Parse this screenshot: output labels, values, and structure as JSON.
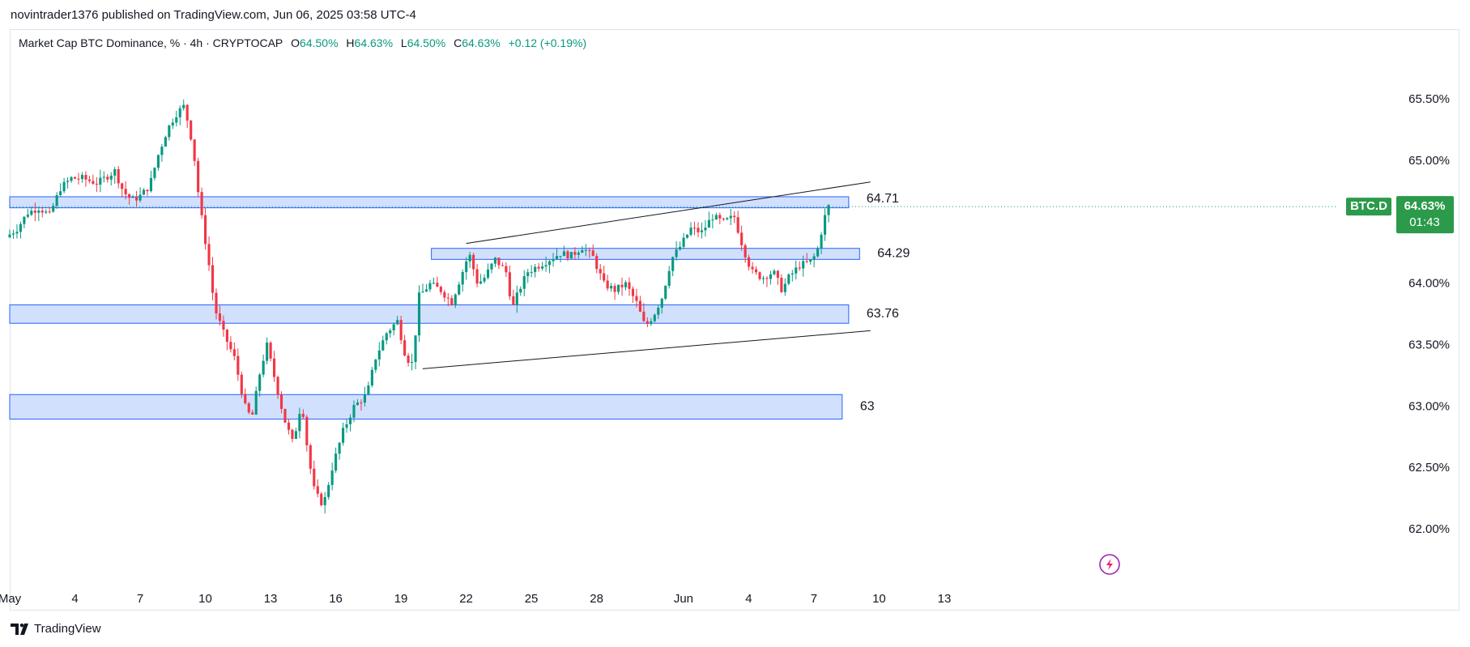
{
  "caption": "novintrader1376 published on TradingView.com, Jun 06, 2025 03:58 UTC-4",
  "legend": {
    "title": "Market Cap BTC Dominance, % · 4h · CRYPTOCAP",
    "o_label": "O",
    "o_value": "64.50%",
    "h_label": "H",
    "h_value": "64.63%",
    "l_label": "L",
    "l_value": "64.50%",
    "c_label": "C",
    "c_value": "64.63%",
    "change": "+0.12 (+0.19%)"
  },
  "logo_text": "TradingView",
  "price_tag": {
    "symbol": "BTC.D",
    "price": "64.63%",
    "countdown": "01:43"
  },
  "colors": {
    "up": "#089981",
    "down": "#f23645",
    "zone_fill": "#d1e0fd",
    "zone_border": "#2962ff",
    "tag": "#2b9a4a"
  },
  "chart_data": {
    "type": "candlestick",
    "interval": "4h",
    "ylim": [
      61.5,
      65.85
    ],
    "xlim": [
      0,
      62.9
    ],
    "x_ticks": [
      {
        "day": 0,
        "label": "May"
      },
      {
        "day": 3,
        "label": "4"
      },
      {
        "day": 6,
        "label": "7"
      },
      {
        "day": 9,
        "label": "10"
      },
      {
        "day": 12,
        "label": "13"
      },
      {
        "day": 15,
        "label": "16"
      },
      {
        "day": 18,
        "label": "19"
      },
      {
        "day": 21,
        "label": "22"
      },
      {
        "day": 24,
        "label": "25"
      },
      {
        "day": 27,
        "label": "28"
      },
      {
        "day": 31,
        "label": "Jun"
      },
      {
        "day": 34,
        "label": "4"
      },
      {
        "day": 37,
        "label": "7"
      },
      {
        "day": 40,
        "label": "10"
      },
      {
        "day": 43,
        "label": "13"
      }
    ],
    "y_ticks": [
      {
        "value": 65.5,
        "label": "65.50%"
      },
      {
        "value": 65.0,
        "label": "65.00%"
      },
      {
        "value": 64.0,
        "label": "64.00%"
      },
      {
        "value": 63.5,
        "label": "63.50%"
      },
      {
        "value": 63.0,
        "label": "63.00%"
      },
      {
        "value": 62.5,
        "label": "62.50%"
      },
      {
        "value": 62.0,
        "label": "62.00%"
      }
    ],
    "last_price": 64.63,
    "zones": [
      {
        "label": "64.71",
        "x0": 0,
        "x1": 38.6,
        "y_low": 64.62,
        "y_high": 64.71
      },
      {
        "label": "64.29",
        "x0": 19.4,
        "x1": 39.1,
        "y_low": 64.2,
        "y_high": 64.29
      },
      {
        "label": "63.76",
        "x0": 0,
        "x1": 38.6,
        "y_low": 63.68,
        "y_high": 63.83
      },
      {
        "label": "63",
        "x0": 0,
        "x1": 38.3,
        "y_low": 62.9,
        "y_high": 63.1
      }
    ],
    "trendlines": [
      {
        "x0": 21.0,
        "y0": 64.33,
        "x1": 39.6,
        "y1": 64.83
      },
      {
        "x0": 19.0,
        "y0": 63.31,
        "x1": 39.6,
        "y1": 63.62
      }
    ],
    "anchors": [
      [
        0,
        64.38
      ],
      [
        0.5,
        64.45
      ],
      [
        1.0,
        64.58
      ],
      [
        1.5,
        64.62
      ],
      [
        2.0,
        64.56
      ],
      [
        2.5,
        64.78
      ],
      [
        3.0,
        64.86
      ],
      [
        3.5,
        64.86
      ],
      [
        4.2,
        64.82
      ],
      [
        5.0,
        64.92
      ],
      [
        5.4,
        64.75
      ],
      [
        5.8,
        64.68
      ],
      [
        6.2,
        64.72
      ],
      [
        6.6,
        64.8
      ],
      [
        7.0,
        65.05
      ],
      [
        7.4,
        65.25
      ],
      [
        7.8,
        65.38
      ],
      [
        8.2,
        65.45
      ],
      [
        8.6,
        65.12
      ],
      [
        8.9,
        64.65
      ],
      [
        9.3,
        64.2
      ],
      [
        9.6,
        63.8
      ],
      [
        10.0,
        63.6
      ],
      [
        10.5,
        63.4
      ],
      [
        11.0,
        63.0
      ],
      [
        11.3,
        62.9
      ],
      [
        11.7,
        63.3
      ],
      [
        12.0,
        63.5
      ],
      [
        12.4,
        63.2
      ],
      [
        12.8,
        62.9
      ],
      [
        13.2,
        62.7
      ],
      [
        13.6,
        63.05
      ],
      [
        13.9,
        62.6
      ],
      [
        14.2,
        62.3
      ],
      [
        14.6,
        62.2
      ],
      [
        15.0,
        62.5
      ],
      [
        15.5,
        62.8
      ],
      [
        16.0,
        63.0
      ],
      [
        16.6,
        63.1
      ],
      [
        17.0,
        63.4
      ],
      [
        17.5,
        63.6
      ],
      [
        18.0,
        63.7
      ],
      [
        18.4,
        63.4
      ],
      [
        18.7,
        63.35
      ],
      [
        19.0,
        63.9
      ],
      [
        19.5,
        64.0
      ],
      [
        20.0,
        63.95
      ],
      [
        20.5,
        63.85
      ],
      [
        21.0,
        64.1
      ],
      [
        21.3,
        64.25
      ],
      [
        21.7,
        64.0
      ],
      [
        22.0,
        64.05
      ],
      [
        22.5,
        64.2
      ],
      [
        23.0,
        64.1
      ],
      [
        23.3,
        63.8
      ],
      [
        23.6,
        63.95
      ],
      [
        24.0,
        64.1
      ],
      [
        24.5,
        64.15
      ],
      [
        25.0,
        64.2
      ],
      [
        25.5,
        64.25
      ],
      [
        26.0,
        64.23
      ],
      [
        26.5,
        64.3
      ],
      [
        27.0,
        64.22
      ],
      [
        27.5,
        64.0
      ],
      [
        28.0,
        63.95
      ],
      [
        28.5,
        64.0
      ],
      [
        29.0,
        63.85
      ],
      [
        29.4,
        63.65
      ],
      [
        29.8,
        63.75
      ],
      [
        30.2,
        63.9
      ],
      [
        30.6,
        64.2
      ],
      [
        31.0,
        64.3
      ],
      [
        31.5,
        64.45
      ],
      [
        32.0,
        64.42
      ],
      [
        32.5,
        64.55
      ],
      [
        33.0,
        64.5
      ],
      [
        33.5,
        64.55
      ],
      [
        33.9,
        64.3
      ],
      [
        34.3,
        64.1
      ],
      [
        34.8,
        64.05
      ],
      [
        35.3,
        64.1
      ],
      [
        35.7,
        63.95
      ],
      [
        36.0,
        64.05
      ],
      [
        36.5,
        64.15
      ],
      [
        37.0,
        64.18
      ],
      [
        37.3,
        64.25
      ],
      [
        37.6,
        64.5
      ],
      [
        37.8,
        64.63
      ]
    ],
    "candle_spacing_days": 0.1667
  }
}
